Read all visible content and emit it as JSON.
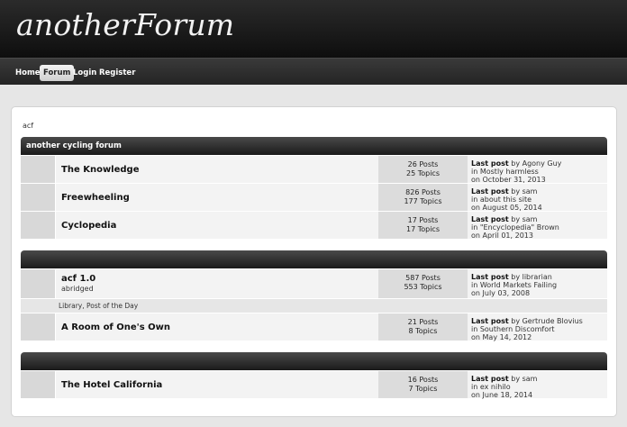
{
  "site": {
    "logo": "anotherForum"
  },
  "nav": {
    "items": [
      {
        "label": "Home",
        "active": false
      },
      {
        "label": "Forum",
        "active": true
      },
      {
        "label": "Login",
        "active": false
      },
      {
        "label": "Register",
        "active": false
      }
    ]
  },
  "breadcrumb": "acf",
  "categories": [
    {
      "title": "another cycling forum",
      "forums": [
        {
          "title": "The Knowledge",
          "posts": "26 Posts",
          "topics": "25 Topics",
          "last_label": "Last post",
          "last_by": "by Agony Guy",
          "last_in": "in Mostly harmless",
          "last_on": "on October 31, 2013"
        },
        {
          "title": "Freewheeling",
          "posts": "826 Posts",
          "topics": "177 Topics",
          "last_label": "Last post",
          "last_by": "by sam",
          "last_in": "in about this site",
          "last_on": "on August 05, 2014"
        },
        {
          "title": "Cyclopedia",
          "posts": "17 Posts",
          "topics": "17 Topics",
          "last_label": "Last post",
          "last_by": "by sam",
          "last_in": "in \"Encyclopedia\" Brown",
          "last_on": "on April 01, 2013"
        }
      ]
    },
    {
      "title": "",
      "forums": [
        {
          "title": "acf 1.0",
          "subtitle": "abridged",
          "posts": "587 Posts",
          "topics": "553 Topics",
          "last_label": "Last post",
          "last_by": "by librarian",
          "last_in": "in World Markets Failing",
          "last_on": "on July 03, 2008",
          "subforums": "Library, Post of the Day"
        },
        {
          "title": "A Room of One's Own",
          "posts": "21 Posts",
          "topics": "8 Topics",
          "last_label": "Last post",
          "last_by": "by Gertrude Blovius",
          "last_in": "in Southern Discomfort",
          "last_on": "on May 14, 2012"
        }
      ]
    },
    {
      "title": "",
      "forums": [
        {
          "title": "The Hotel California",
          "posts": "16 Posts",
          "topics": "7 Topics",
          "last_label": "Last post",
          "last_by": "by sam",
          "last_in": "in ex nihilo",
          "last_on": "on June 18, 2014"
        }
      ]
    }
  ]
}
